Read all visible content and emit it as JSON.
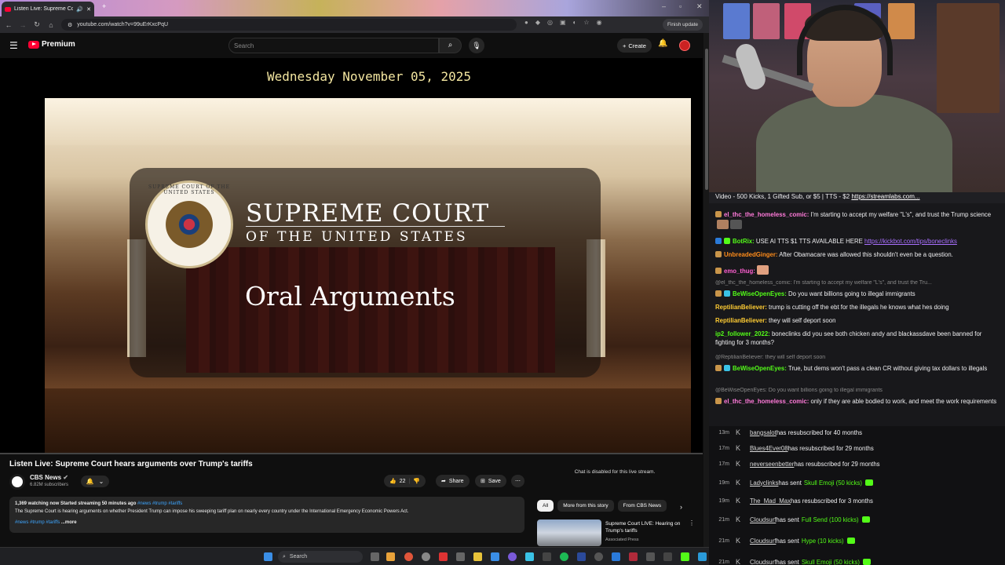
{
  "browser": {
    "tab_title": "Listen Live: Supreme Court",
    "url": "youtube.com/watch?v=99uErKxcPqU",
    "finish_update": "Finish update"
  },
  "youtube": {
    "brand": "Premium",
    "search_placeholder": "Search",
    "create_label": "Create"
  },
  "video": {
    "date_banner": "Wednesday November 05, 2025",
    "court_title": "SUPREME COURT",
    "court_subtitle": "OF THE UNITED STATES",
    "seal_text": "SUPREME COURT OF THE UNITED STATES",
    "session": "Oral Arguments"
  },
  "meta": {
    "title": "Listen Live: Supreme Court hears arguments over Trump's tariffs",
    "channel": "CBS News",
    "subscribers": "6.82M subscribers",
    "likes": "22",
    "share": "Share",
    "save": "Save",
    "views_line": "1,369 watching now  Started streaming 50 minutes ago",
    "views_tags": "#news #trump #tariffs",
    "description": "The Supreme Court is hearing arguments on whether President Trump can impose his sweeping tariff plan on nearly every country under the International Emergency Economic Powers Act.",
    "desc_tags": "#news #trump #tariffs",
    "more": "...more",
    "chat_disabled": "Chat is disabled for this live stream.",
    "chips": [
      "All",
      "More from this story",
      "From CBS News"
    ],
    "rec_title": "Supreme Court LIVE: Hearing on Trump's tariffs",
    "rec_source": "Associated Press"
  },
  "taskbar": {
    "search": "Search"
  },
  "chat": {
    "banner_text": "Video - 500 Kicks, 1 Gifted Sub, or $5 | TTS - $2 ",
    "banner_link": "https://streamlabs.com...",
    "messages": [
      {
        "user": "el_thc_the_homeless_comic:",
        "text": " I'm starting to accept my welfare \"L's\", and trust the Trump science",
        "color": "#ff7ad9"
      },
      {
        "user": "BotRix:",
        "text": " USE AI TTS $1 TTS AVAILABLE HERE ",
        "link": "https://kickbot.com/tips/boneclinks",
        "color": "#53fc18"
      },
      {
        "user": "UnbreadedGinger:",
        "text": " After Obamacare was allowed this shouldn't even be a question.",
        "color": "#ff8c1a"
      },
      {
        "user": "emo_thug:",
        "text": "",
        "color": "#ff5fd2"
      },
      {
        "user": "BeWiseOpenEyes:",
        "text": " Do you want billions going to illegal immigrants",
        "color": "#53fc18"
      },
      {
        "user": "ReptilianBeliever:",
        "text": " trump is cutting off the ebt for the illegals he knows what hes doing",
        "color": "#ffcc33"
      },
      {
        "user": "ReptilianBeliever:",
        "text": " they will self deport soon",
        "color": "#ffcc33"
      },
      {
        "user": "ip2_follower_2022:",
        "text": " boneclinks did you see both chicken andy and blackassdave been banned for fighting for 3 months?",
        "color": "#53fc18"
      },
      {
        "user": "BeWiseOpenEyes:",
        "text": " True, but dems won't pass a clean CR without giving tax dollars to illegals",
        "color": "#53fc18"
      },
      {
        "user": "el_thc_the_homeless_comic:",
        "text": " only if they are able bodied to work, and meet the work requirements",
        "color": "#ff7ad9"
      }
    ],
    "replies": [
      "@el_thc_the_homeless_comic: I'm starting to accept my welfare \"L's\", and trust the Tru...",
      "@ReptilianBeliever: they will self deport soon",
      "@BeWiseOpenEyes: Do you want billions going to illegal immigrants"
    ],
    "events": [
      {
        "time": "13m",
        "name": "bangsalot",
        "text": " has resubscribed for 40 months",
        "gift": ""
      },
      {
        "time": "17m",
        "name": "Blues4Ever08",
        "text": " has resubscribed for 29 months",
        "gift": ""
      },
      {
        "time": "17m",
        "name": "neverseenbetter",
        "text": " has resubscribed for 29 months",
        "gift": ""
      },
      {
        "time": "19m",
        "name": "Ladyclinks",
        "text": " has sent ",
        "gift": "Skull Emoji (50 kicks)"
      },
      {
        "time": "19m",
        "name": "The_Mad_Max",
        "text": " has resubscribed for 3 months",
        "gift": ""
      },
      {
        "time": "21m",
        "name": "Cloudsurf",
        "text": " has sent ",
        "gift": "Full Send (100 kicks)"
      },
      {
        "time": "21m",
        "name": "Cloudsurf",
        "text": " has sent ",
        "gift": "Hype (10 kicks)"
      },
      {
        "time": "21m",
        "name": "Cloudsurf",
        "text": " has sent ",
        "gift": "Skull Emoji (50 kicks)"
      }
    ]
  }
}
